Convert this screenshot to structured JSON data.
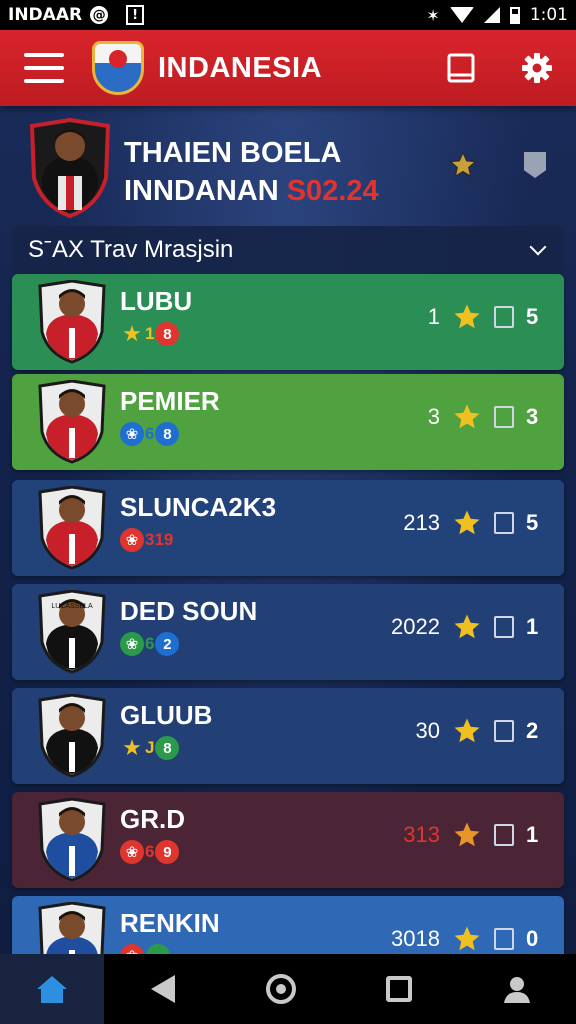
{
  "status_bar": {
    "carrier": "INDAAR",
    "time": "1:01"
  },
  "app_bar": {
    "title": "INDANESIA"
  },
  "profile": {
    "line1": "THAIEN BOELA",
    "line2_main": "INNDANAN ",
    "line2_accent": "S02.24",
    "accent_color": "#e0352f"
  },
  "filter": {
    "label": "SˉAX  Trav Mrasjsin"
  },
  "clubs": [
    {
      "name": "LUBU",
      "badge_text": "",
      "rank": "1",
      "count": "5",
      "card_color": "#2b8f55",
      "rank_color": "#ffffff",
      "pills": [
        {
          "glyph": "★",
          "bg": "#f0c020",
          "fg": "#f0c020"
        },
        {
          "text": "1"
        },
        {
          "glyph": "8",
          "bg": "#e0352f",
          "fg": "#fff"
        }
      ]
    },
    {
      "name": "PEMIER",
      "badge_text": "",
      "rank": "3",
      "count": "3",
      "card_color": "#4fa23f",
      "rank_color": "#ffffff",
      "pills": [
        {
          "glyph": "❀",
          "bg": "#1f6fd0",
          "fg": "#fff"
        },
        {
          "text": "6"
        },
        {
          "glyph": "8",
          "bg": "#1f6fd0",
          "fg": "#fff"
        }
      ]
    },
    {
      "name": "SLUNCA2K3",
      "badge_text": "",
      "rank": "213",
      "count": "5",
      "card_color": "#22427a",
      "rank_color": "#ffffff",
      "pills": [
        {
          "glyph": "❀",
          "bg": "#e0352f",
          "fg": "#fff"
        },
        {
          "text": "319"
        }
      ]
    },
    {
      "name": "DED SOUN",
      "badge_text": "LUCASSELA",
      "rank": "2022",
      "count": "1",
      "card_color": "#223f76",
      "rank_color": "#ffffff",
      "pills": [
        {
          "glyph": "❀",
          "bg": "#2b9a4a",
          "fg": "#fff"
        },
        {
          "text": "6"
        },
        {
          "glyph": "2",
          "bg": "#1f6fd0",
          "fg": "#fff"
        }
      ]
    },
    {
      "name": "GLUUB",
      "badge_text": "",
      "rank": "30",
      "count": "2",
      "card_color": "#223f76",
      "rank_color": "#ffffff",
      "pills": [
        {
          "glyph": "★",
          "bg": "#f0c020",
          "fg": "#f0c020"
        },
        {
          "text": "J"
        },
        {
          "glyph": "8",
          "bg": "#2b9a4a",
          "fg": "#fff"
        }
      ]
    },
    {
      "name": "GR.D",
      "badge_text": "",
      "rank": "313",
      "count": "1",
      "card_color": "#4b2436",
      "rank_color": "#e0352f",
      "pills": [
        {
          "glyph": "❀",
          "bg": "#e0352f",
          "fg": "#fff"
        },
        {
          "text": "6"
        },
        {
          "glyph": "9",
          "bg": "#e0352f",
          "fg": "#fff"
        }
      ]
    },
    {
      "name": "RENKIN",
      "badge_text": "",
      "rank": "3018",
      "count": "0",
      "card_color": "#2f68b4",
      "rank_color": "#ffffff",
      "pills": [
        {
          "glyph": "❀",
          "bg": "#e0352f",
          "fg": "#fff"
        },
        {
          "text": ""
        },
        {
          "glyph": "",
          "bg": "#2b9a4a",
          "fg": "#fff"
        }
      ]
    }
  ],
  "icons": {
    "menu": "menu-icon",
    "crest": "crest-icon",
    "book": "book-icon",
    "settings": "gear-icon",
    "star": "star-icon",
    "home": "home-icon",
    "back": "back-icon",
    "circle": "home-circle-icon",
    "recents": "recents-icon",
    "profile": "person-icon"
  }
}
